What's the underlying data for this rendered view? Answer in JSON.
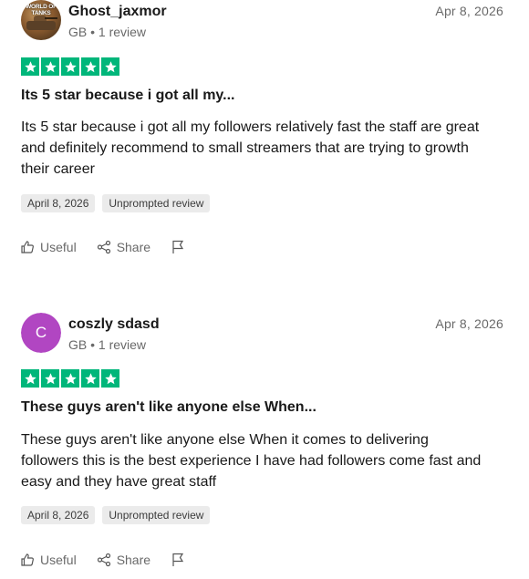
{
  "reviews": [
    {
      "name": "Ghost_jaxmor",
      "meta": "GB • 1 review",
      "date": "Apr 8, 2026",
      "rating": 5,
      "avatar": {
        "type": "image",
        "logo_text": "WORLD OF TANKS"
      },
      "title": "Its 5 star because i got all my...",
      "body_lines": [
        "Its 5 star because i got all my followers relatively fast the staff are great",
        "and definitely recommend to small streamers that are trying to growth",
        "their career"
      ],
      "tags": [
        "April 8, 2026",
        "Unprompted review"
      ],
      "actions": {
        "useful": "Useful",
        "share": "Share"
      }
    },
    {
      "name": "coszly sdasd",
      "meta": "GB • 1 review",
      "date": "Apr 8, 2026",
      "rating": 5,
      "avatar": {
        "type": "initial",
        "letter": "C",
        "color": "#b146c2"
      },
      "title": "These guys aren't like anyone else When...",
      "body_lines": [
        "These guys aren't like anyone else When it comes to delivering",
        "followers this is the best experience I have had followers come fast and",
        "easy and they have great staff"
      ],
      "tags": [
        "April 8, 2026",
        "Unprompted review"
      ],
      "actions": {
        "useful": "Useful",
        "share": "Share"
      }
    }
  ],
  "colors": {
    "star_green": "#00b67a",
    "tag_bg": "#ebebeb",
    "muted_text": "#696969"
  }
}
